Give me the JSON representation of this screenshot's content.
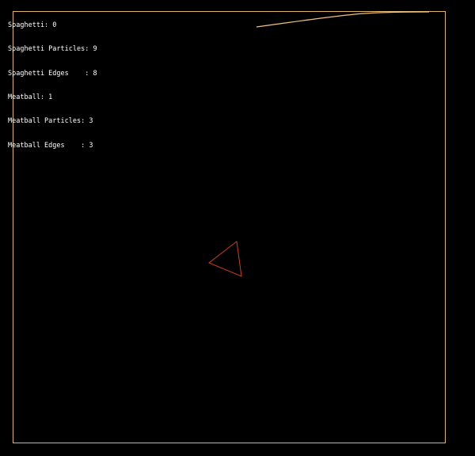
{
  "hud": [
    "Spaghetti: 0",
    "Spaghetti Particles: 9",
    "Spaghetti Edges    : 8",
    "Meatball: 1",
    "Meatball Particles: 3",
    "Meatball Edges    : 3"
  ],
  "colors": {
    "background": "#000000",
    "boundary": "#e0b56a",
    "spaghetti": "#f0c27a",
    "meatball": "#c8401c",
    "text": "#ffffff"
  }
}
